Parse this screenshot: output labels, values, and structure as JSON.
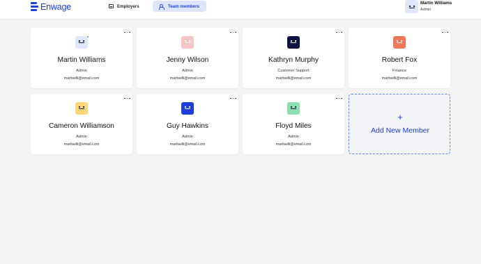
{
  "app": {
    "logo_text": "Enwage",
    "brand_color": "#1d3fd8"
  },
  "nav": {
    "tabs": [
      {
        "label": "Employers",
        "icon": "list-icon",
        "active": false
      },
      {
        "label": "Team members",
        "icon": "people-icon",
        "active": true
      }
    ]
  },
  "user": {
    "name": "Martin Williams",
    "role": "Admin",
    "avatar_color": "#dfe7fb"
  },
  "members": [
    {
      "name": "Martin Williams",
      "role": "Admin",
      "email": "martiwilli@email.com",
      "avatar_color": "#dfe7fb",
      "face_color": "#1a1a3a",
      "online": true
    },
    {
      "name": "Jenny Wilson",
      "role": "Admin",
      "email": "martiwilli@email.com",
      "avatar_color": "#f6c6c6",
      "face_color": "#ffffff",
      "online": false
    },
    {
      "name": "Kathryn Murphy",
      "role": "Customer Support",
      "email": "martiwilli@email.com",
      "avatar_color": "#0d1240",
      "face_color": "#ffffff",
      "online": false
    },
    {
      "name": "Robert Fox",
      "role": "Finance",
      "email": "martiwilli@email.com",
      "avatar_color": "#f0785a",
      "face_color": "#ffffff",
      "online": false
    },
    {
      "name": "Cameron Williamson",
      "role": "Admin",
      "email": "martiwilli@email.com",
      "avatar_color": "#fbd97a",
      "face_color": "#1a1a3a",
      "online": false
    },
    {
      "name": "Guy Hawkins",
      "role": "Admin",
      "email": "martiwilli@email.com",
      "avatar_color": "#1d3fd8",
      "face_color": "#ffffff",
      "online": false
    },
    {
      "name": "Floyd Miles",
      "role": "Admin",
      "email": "martiwilli@email.com",
      "avatar_color": "#8fe0b0",
      "face_color": "#1a1a3a",
      "online": false
    }
  ],
  "add_member": {
    "plus": "+",
    "label": "Add New Member"
  }
}
